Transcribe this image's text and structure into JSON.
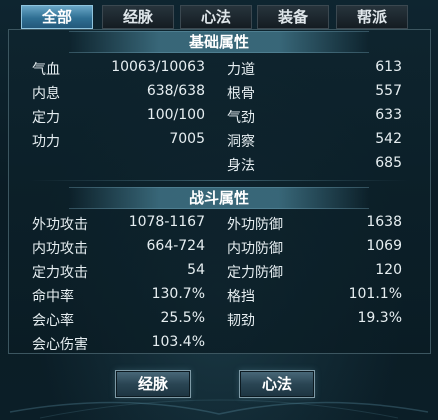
{
  "tabs": [
    {
      "label": "全部",
      "active": true
    },
    {
      "label": "经脉",
      "active": false
    },
    {
      "label": "心法",
      "active": false
    },
    {
      "label": "装备",
      "active": false
    },
    {
      "label": "帮派",
      "active": false
    }
  ],
  "basic": {
    "title": "基础属性",
    "left": [
      {
        "label": "气血",
        "value": "10063/10063"
      },
      {
        "label": "内息",
        "value": "638/638"
      },
      {
        "label": "定力",
        "value": "100/100"
      },
      {
        "label": "功力",
        "value": "7005"
      }
    ],
    "right": [
      {
        "label": "力道",
        "value": "613"
      },
      {
        "label": "根骨",
        "value": "557"
      },
      {
        "label": "气劲",
        "value": "633"
      },
      {
        "label": "洞察",
        "value": "542"
      },
      {
        "label": "身法",
        "value": "685"
      }
    ]
  },
  "combat": {
    "title": "战斗属性",
    "left": [
      {
        "label": "外功攻击",
        "value": "1078-1167"
      },
      {
        "label": "内功攻击",
        "value": "664-724"
      },
      {
        "label": "定力攻击",
        "value": "54"
      },
      {
        "label": "命中率",
        "value": "130.7%"
      },
      {
        "label": "会心率",
        "value": "25.5%"
      },
      {
        "label": "会心伤害",
        "value": "103.4%"
      }
    ],
    "right": [
      {
        "label": "外功防御",
        "value": "1638"
      },
      {
        "label": "内功防御",
        "value": "1069"
      },
      {
        "label": "定力防御",
        "value": "120"
      },
      {
        "label": "格挡",
        "value": "101.1%"
      },
      {
        "label": "韧劲",
        "value": "19.3%"
      }
    ]
  },
  "buttons": {
    "meridian": "经脉",
    "heart_method": "心法"
  },
  "colors": {
    "active_tab": "#3a7fa5",
    "panel_border": "#3c5660",
    "text": "#e6eef1"
  }
}
